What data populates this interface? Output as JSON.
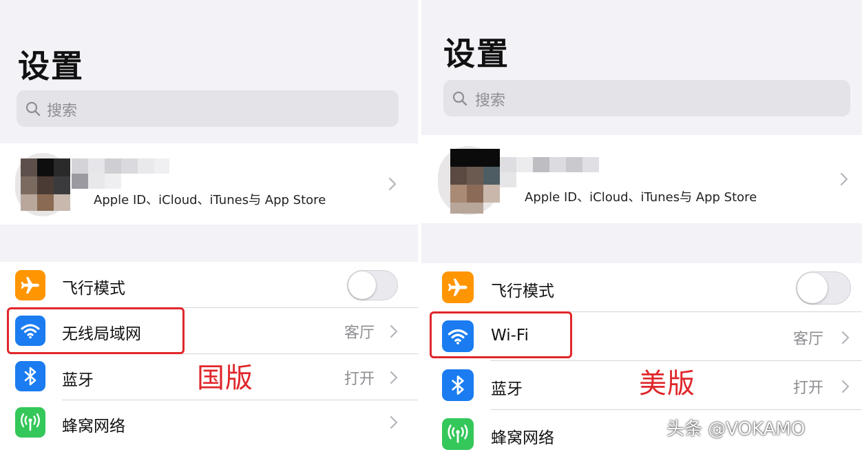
{
  "left": {
    "title": "设置",
    "search_placeholder": "搜索",
    "account_subtitle": "Apple ID、iCloud、iTunes与 App Store",
    "rows": [
      {
        "label": "飞行模式",
        "value": "",
        "icon": "airplane-icon",
        "color": "#ff9500"
      },
      {
        "label": "无线局域网",
        "value": "客厅",
        "icon": "wifi-icon",
        "color": "#1a7cf0"
      },
      {
        "label": "蓝牙",
        "value": "打开",
        "icon": "bluetooth-icon",
        "color": "#1a7cf0"
      },
      {
        "label": "蜂窝网络",
        "value": "",
        "icon": "cellular-icon",
        "color": "#34c759"
      }
    ],
    "annotation": "国版"
  },
  "right": {
    "title": "设置",
    "search_placeholder": "搜索",
    "account_subtitle": "Apple ID、iCloud、iTunes与 App Store",
    "rows": [
      {
        "label": "飞行模式",
        "value": "",
        "icon": "airplane-icon",
        "color": "#ff9500"
      },
      {
        "label": "Wi-Fi",
        "value": "客厅",
        "icon": "wifi-icon",
        "color": "#1a7cf0"
      },
      {
        "label": "蓝牙",
        "value": "打开",
        "icon": "bluetooth-icon",
        "color": "#1a7cf0"
      },
      {
        "label": "蜂窝网络",
        "value": "",
        "icon": "cellular-icon",
        "color": "#34c759"
      }
    ],
    "annotation": "美版"
  },
  "watermark": "头条 @VOKAMO",
  "colors": {
    "highlight": "#e0262a",
    "annotation": "#e0262a"
  }
}
